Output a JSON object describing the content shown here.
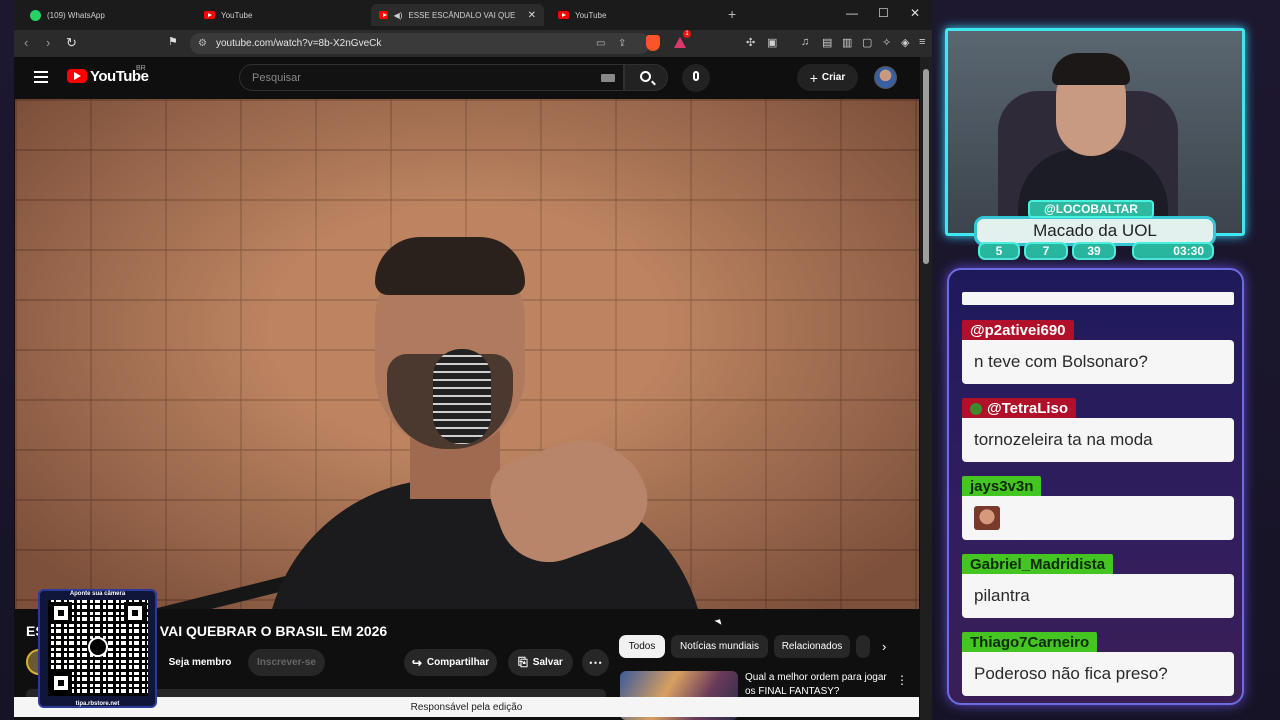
{
  "browser": {
    "tabs": [
      {
        "title": "(109) WhatsApp",
        "icon": "whatsapp-icon"
      },
      {
        "title": "YouTube",
        "icon": "youtube-icon"
      },
      {
        "title": "ESSE ESCÂNDALO VAI QUEBRAR O",
        "icon": "youtube-icon",
        "active": true
      },
      {
        "title": "YouTube",
        "icon": "youtube-icon"
      }
    ],
    "url": "youtube.com/watch?v=8b-X2nGveCk",
    "brave_badge": "1"
  },
  "youtube": {
    "logo_text": "YouTube",
    "region": "BR",
    "search_placeholder": "Pesquisar",
    "create_label": "Criar",
    "video_title": "ESSE ESCÂNDALO VAI QUEBRAR O BRASIL EM 2026",
    "member_label": "Seja membro",
    "subscribe_label": "Inscrever-se",
    "share_label": "Compartilhar",
    "save_label": "Salvar",
    "chips": [
      "Todos",
      "Notícias mundiais",
      "Relacionados"
    ],
    "recommended_title": "Qual a melhor ordem para jogar os FINAL FANTASY?",
    "edit_notice": "Responsável pela edição"
  },
  "qr_overlay": {
    "top_text": "Aponte sua câmera",
    "bottom_text": "tipa.rbstore.net"
  },
  "stream": {
    "handle": "@LOCOBALTAR",
    "display_name": "Macado da UOL",
    "stats": [
      "5",
      "7",
      "39",
      "03:30"
    ],
    "accent_color": "#3fe8f0"
  },
  "chat": {
    "messages": [
      {
        "user": "@p2ativei690",
        "text": "n teve com Bolsonaro?",
        "color": "#b0102a"
      },
      {
        "user": "@TetraLiso",
        "text": "tornozeleira ta na moda",
        "color": "#b0102a"
      },
      {
        "user": "jays3v3n",
        "text": "",
        "color": "#44c522"
      },
      {
        "user": "Gabriel_Madridista",
        "text": "pilantra",
        "color": "#44c522"
      },
      {
        "user": "Thiago7Carneiro",
        "text": "Poderoso não fica preso?",
        "color": "#44c522"
      }
    ]
  }
}
